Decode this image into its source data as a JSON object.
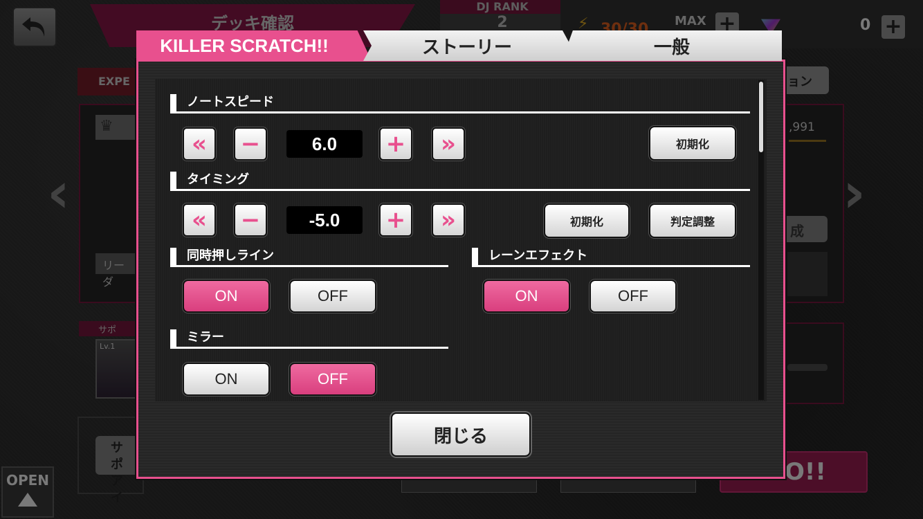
{
  "background": {
    "title": "デッキ確認",
    "dj_rank_label": "DJ RANK",
    "dj_rank_value": "2",
    "stamina": "30/30",
    "max_label": "MAX",
    "gem_count": "0",
    "expert_label": "EXPE",
    "leader_label": "リーダ",
    "support_label": "サポート",
    "support_level": "Lv.1",
    "support_button": "サポ\nアイ",
    "score": ",991",
    "right_tab": "ョン",
    "right_button": "成",
    "go_label": "O!!",
    "open_label": "OPEN"
  },
  "modal": {
    "tabs": [
      {
        "label": "KILLER SCRATCH!!",
        "active": true
      },
      {
        "label": "ストーリー",
        "active": false
      },
      {
        "label": "一般",
        "active": false
      }
    ],
    "note_speed": {
      "heading": "ノートスピード",
      "value": "6.0",
      "reset_label": "初期化"
    },
    "timing": {
      "heading": "タイミング",
      "value": "-5.0",
      "reset_label": "初期化",
      "adjust_label": "判定調整"
    },
    "simultaneous_line": {
      "heading": "同時押しライン",
      "on_label": "ON",
      "off_label": "OFF",
      "selected": "ON"
    },
    "lane_effect": {
      "heading": "レーンエフェクト",
      "on_label": "ON",
      "off_label": "OFF",
      "selected": "ON"
    },
    "mirror": {
      "heading": "ミラー",
      "on_label": "ON",
      "off_label": "OFF",
      "selected": "OFF"
    },
    "close_label": "閉じる"
  },
  "colors": {
    "accent_pink": "#e8508e",
    "dark_bg": "#262626"
  }
}
